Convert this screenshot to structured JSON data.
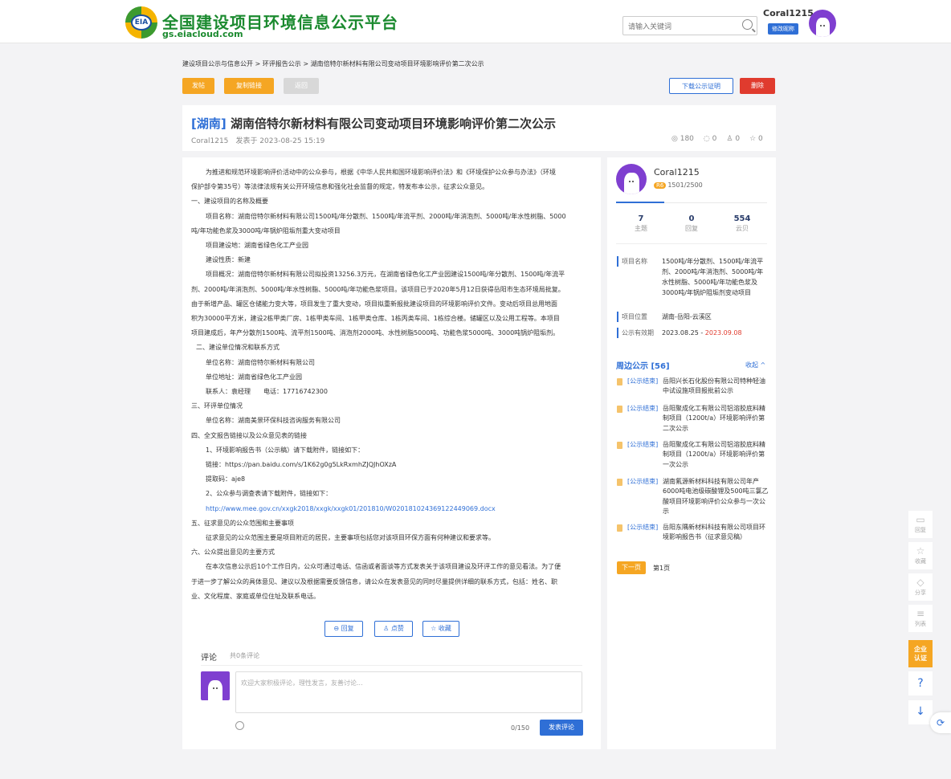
{
  "header": {
    "site_title": "全国建设项目环境信息公示平台",
    "site_url": "gs.eiacloud.com",
    "logo_text": "EIA",
    "search_placeholder": "请输入关键词",
    "user_name": "Coral1215",
    "edit_label": "修改昵称"
  },
  "breadcrumb": "建设项目公示与信息公开 > 环评报告公示 > 湖南倍特尔新材料有限公司变动项目环境影响评价第二次公示",
  "toolbar": {
    "post": "发帖",
    "copy": "复制链接",
    "back": "返回",
    "download": "下载公示证明",
    "delete": "删除"
  },
  "article": {
    "province": "[湖南]",
    "title": "湖南倍特尔新材料有限公司变动项目环境影响评价第二次公示",
    "author": "Coral1215",
    "posted": "发表于 2023-08-25 15:19",
    "views": "180",
    "comments": "0",
    "likes": "0",
    "favs": "0",
    "lines": [
      "为推进和规范环境影响评价活动中的公众参与，根据《中华人民共和国环境影响评价法》和《环境保护公众参与办法》（环境",
      "保护部令第35号）等法律法规有关公开环境信息和强化社会监督的规定，特发布本公示，征求公众意见。",
      "一、建设项目的名称及概要",
      "项目名称：湖南倍特尔新材料有限公司1500吨/年分散剂、1500吨/年流平剂、2000吨/年消泡剂、5000吨/年水性树脂、5000",
      "吨/年功能色浆及3000吨/年锅炉阻垢剂重大变动项目",
      "项目建设地：湖南省绿色化工产业园",
      "建设性质：新建",
      "项目概况：湖南倍特尔新材料有限公司拟投资13256.3万元，在湖南省绿色化工产业园建设1500吨/年分散剂、1500吨/年流平",
      "剂、2000吨/年消泡剂、5000吨/年水性树脂、5000吨/年功能色浆项目。该项目已于2020年5月12日获得岳阳市生态环境局批复。",
      "由于新增产品、罐区仓储能力变大等，项目发生了重大变动，项目拟重新报批建设项目的环境影响评价文件。变动后项目总用地面",
      "积为30000平方米，建设2栋甲类厂房、1栋甲类车间、1栋甲类仓库、1栋丙类车间、1栋综合楼。储罐区以及公用工程等。本项目",
      "项目建成后，年产分散剂1500吨、流平剂1500吨、消泡剂2000吨、水性树脂5000吨、功能色浆5000吨、3000吨锅炉阻垢剂。",
      "二、建设单位情况和联系方式",
      "单位名称：湖南倍特尔新材料有限公司",
      "单位地址：湖南省绿色化工产业园",
      "联系人：袁经理　　电话：17716742300",
      "三、环评单位情况",
      "单位名称：湖南美景环保科技咨询服务有限公司",
      "四、全文报告链接以及公众意见表的链接",
      "1、环境影响报告书（公示稿）请下载附件，链接如下：",
      "链接：https://pan.baidu.com/s/1K62g0g5LkRxmhZJQJhOXzA",
      "提取码：aje8",
      "2、公众参与调查表请下载附件，链接如下：",
      "http://www.mee.gov.cn/xxgk2018/xxgk/xxgk01/201810/W020181024369122449069.docx",
      "五、征求意见的公众范围和主要事项",
      "征求意见的公众范围主要是项目附近的居民，主要事项包括您对该项目环保方面有何种建议和要求等。",
      "六、公众提出意见的主要方式",
      "在本次信息公示后10个工作日内，公众可通过电话、信函或者面谈等方式发表关于该项目建设及环评工作的意见看法。为了便",
      "于进一步了解公众的具体意见、建议以及根据需要反馈信息，请公众在发表意见的同时尽量提供详细的联系方式，包括：姓名、职",
      "业、文化程度、家庭或单位住址及联系电话。"
    ]
  },
  "actions": {
    "reply": "回复",
    "like": "点赞",
    "fav": "收藏"
  },
  "comment": {
    "label": "评论",
    "count": "共0条评论",
    "placeholder": "欢迎大家积极评论，理性发言，友善讨论...",
    "counter": "0/150",
    "submit": "发表评论"
  },
  "sidebar": {
    "name": "Coral1215",
    "level": "R6",
    "level_progress": "1501/2500",
    "stats": [
      {
        "n": "7",
        "l": "主题"
      },
      {
        "n": "0",
        "l": "回复"
      },
      {
        "n": "554",
        "l": "云贝"
      }
    ],
    "info": {
      "name_k": "项目名称",
      "name_v": "1500吨/年分散剂、1500吨/年流平剂、2000吨/年消泡剂、5000吨/年水性树脂、5000吨/年功能色浆及3000吨/年锅炉阻垢剂变动项目",
      "loc_k": "项目位置",
      "loc_v": "湖南-岳阳-云溪区",
      "valid_k": "公示有效期",
      "valid_start": "2023.08.25 -",
      "valid_end": "2023.09.08"
    },
    "nearby_title": "周边公示 [56]",
    "collapse": "收起 ^",
    "nearby": [
      {
        "tag": "[公示结束]",
        "text": "岳阳兴长石化股份有限公司特种轻油中试设施项目报批前公示"
      },
      {
        "tag": "[公示结束]",
        "text": "岳阳聚成化工有限公司铝溶胶底料精制项目（1200t/a）环境影响评价第二次公示"
      },
      {
        "tag": "[公示结束]",
        "text": "岳阳聚成化工有限公司铝溶胶底料精制项目（1200t/a）环境影响评价第一次公示"
      },
      {
        "tag": "[公示结束]",
        "text": "湖南氟源新材料科技有限公司年产6000吨电池级碳酸锂及500吨三氯乙酸项目环境影响评价公众参与一次公示"
      },
      {
        "tag": "[公示结束]",
        "text": "岳阳东隅新材料科技有限公司项目环境影响报告书（征求意见稿）"
      }
    ],
    "next": "下一页",
    "page": "第1页"
  },
  "float": {
    "reply": "回复",
    "fav": "收藏",
    "share": "分享",
    "list": "列表",
    "cert": "企业认证"
  }
}
